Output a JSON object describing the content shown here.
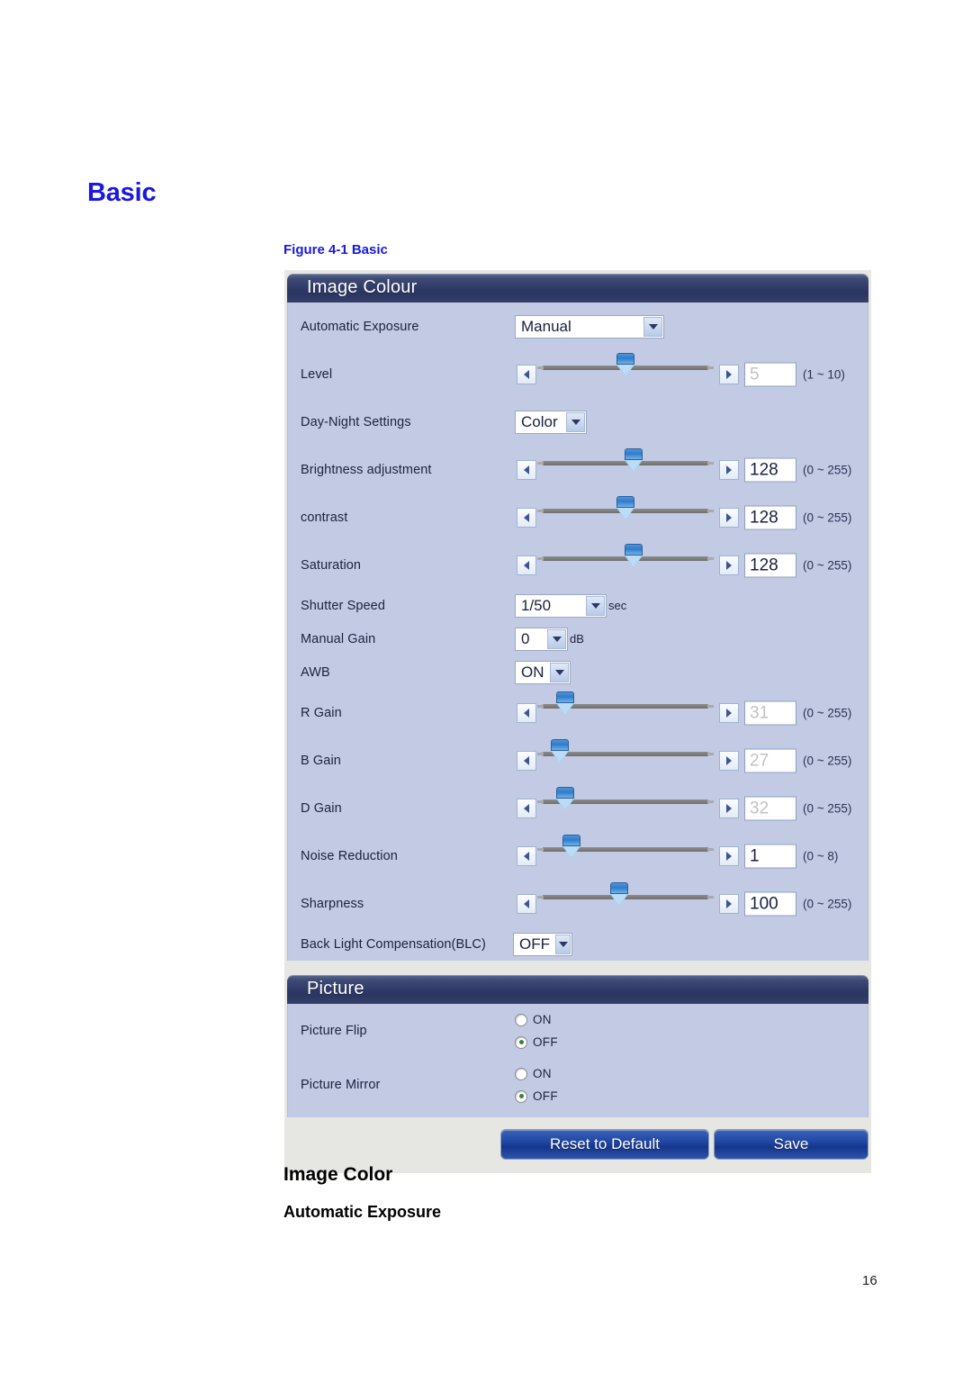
{
  "document": {
    "heading": "Basic",
    "figure_caption": "Figure 4-1 Basic",
    "section_heading": "Image Color",
    "sub_heading": "Automatic Exposure",
    "page_number": "16",
    "heading_color": "#1818e0"
  },
  "image_colour_panel": {
    "title": "Image Colour",
    "rows": {
      "automatic_exposure": {
        "label": "Automatic Exposure",
        "value": "Manual"
      },
      "level": {
        "label": "Level",
        "value": "5",
        "range": "(1 ~ 10)",
        "thumb_pct": 50
      },
      "day_night": {
        "label": "Day-Night Settings",
        "value": "Color"
      },
      "brightness": {
        "label": "Brightness adjustment",
        "value": "128",
        "range": "(0 ~ 255)",
        "thumb_pct": 50
      },
      "contrast": {
        "label": "contrast",
        "value": "128",
        "range": "(0 ~ 255)",
        "thumb_pct": 50
      },
      "saturation": {
        "label": "Saturation",
        "value": "128",
        "range": "(0 ~ 255)",
        "thumb_pct": 50
      },
      "shutter_speed": {
        "label": "Shutter Speed",
        "value": "1/50",
        "unit": "sec"
      },
      "manual_gain": {
        "label": "Manual Gain",
        "value": "0",
        "unit": "dB"
      },
      "awb": {
        "label": "AWB",
        "value": "ON"
      },
      "r_gain": {
        "label": "R Gain",
        "value": "31",
        "range": "(0 ~ 255)",
        "thumb_pct": 14
      },
      "b_gain": {
        "label": "B Gain",
        "value": "27",
        "range": "(0 ~ 255)",
        "thumb_pct": 11
      },
      "d_gain": {
        "label": "D Gain",
        "value": "32",
        "range": "(0 ~ 255)",
        "thumb_pct": 14
      },
      "noise_reduction": {
        "label": "Noise Reduction",
        "value": "1",
        "range": "(0 ~ 8)",
        "thumb_pct": 16
      },
      "sharpness": {
        "label": "Sharpness",
        "value": "100",
        "range": "(0 ~ 255)",
        "thumb_pct": 40
      },
      "blc": {
        "label": "Back Light Compensation(BLC)",
        "value": "OFF"
      }
    }
  },
  "picture_panel": {
    "title": "Picture",
    "picture_flip": {
      "label": "Picture Flip",
      "on_label": "ON",
      "off_label": "OFF",
      "selected": "OFF"
    },
    "picture_mirror": {
      "label": "Picture Mirror",
      "on_label": "ON",
      "off_label": "OFF",
      "selected": "OFF"
    }
  },
  "footer": {
    "reset_label": "Reset to Default",
    "save_label": "Save"
  },
  "colors": {
    "panel_header": "#2c3763",
    "panel_body": "#c3cbe4",
    "footer_bg": "#e6e6e3",
    "button_blue": "#1f46a2",
    "radio_dot": "#3c7f3c"
  }
}
